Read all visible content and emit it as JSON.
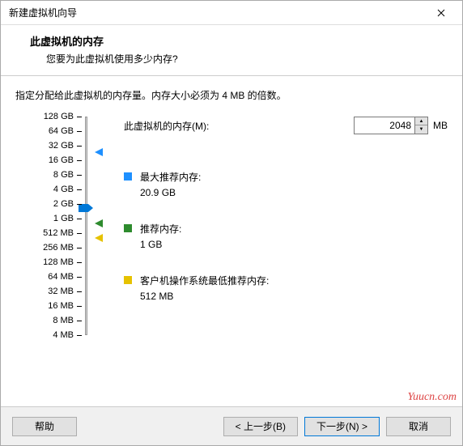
{
  "window": {
    "title": "新建虚拟机向导"
  },
  "header": {
    "title": "此虚拟机的内存",
    "sub": "您要为此虚拟机使用多少内存?"
  },
  "instruction": "指定分配给此虚拟机的内存量。内存大小必须为 4 MB 的倍数。",
  "memory": {
    "label": "此虚拟机的内存(M):",
    "value": "2048",
    "unit": "MB"
  },
  "scale": [
    "128 GB",
    "64 GB",
    "32 GB",
    "16 GB",
    "8 GB",
    "4 GB",
    "2 GB",
    "1 GB",
    "512 MB",
    "256 MB",
    "128 MB",
    "64 MB",
    "32 MB",
    "16 MB",
    "8 MB",
    "4 MB"
  ],
  "recs": {
    "max": {
      "label": "最大推荐内存:",
      "value": "20.9 GB",
      "color": "#1e90ff"
    },
    "rec": {
      "label": "推荐内存:",
      "value": "1 GB",
      "color": "#2e8b2e"
    },
    "min": {
      "label": "客户机操作系统最低推荐内存:",
      "value": "512 MB",
      "color": "#e6c200"
    }
  },
  "buttons": {
    "help": "帮助",
    "back": "< 上一步(B)",
    "next": "下一步(N) >",
    "cancel": "取消"
  },
  "watermark": "Yuucn.com"
}
